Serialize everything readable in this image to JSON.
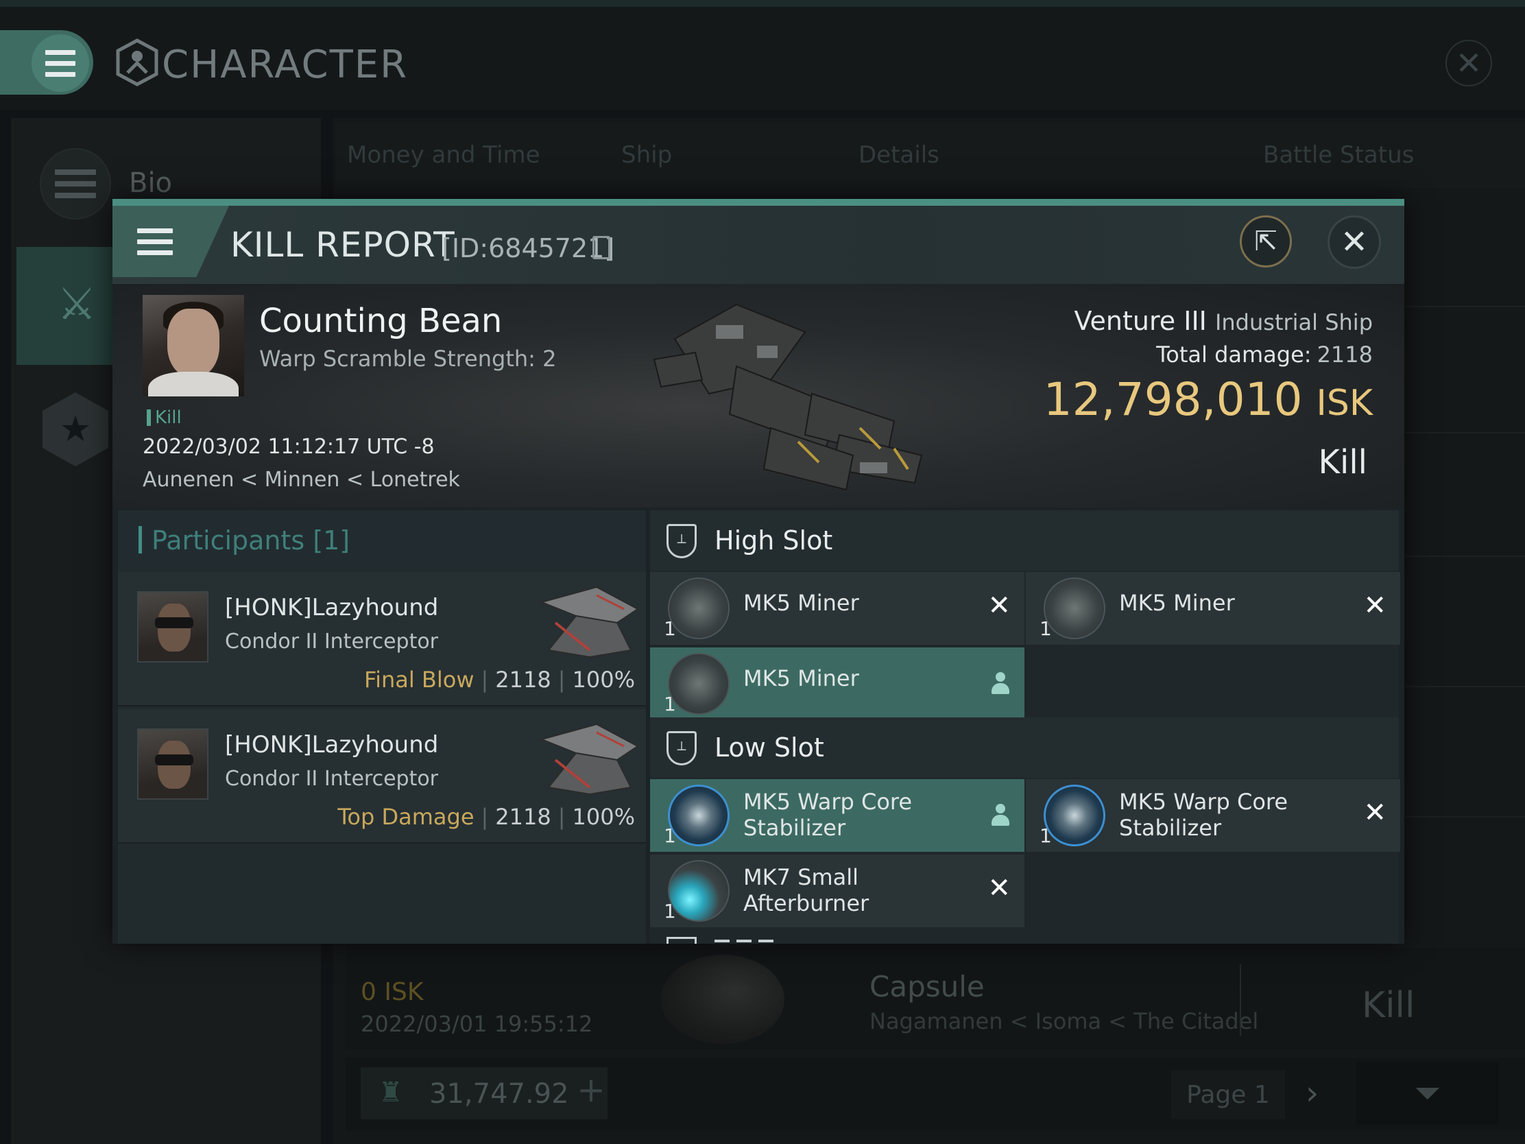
{
  "window": {
    "title": "CHARACTER"
  },
  "sidebar": {
    "items": [
      {
        "label": "Bio",
        "icon": "menu-icon"
      },
      {
        "label": "",
        "icon": "crossed-swords-icon"
      },
      {
        "label": "",
        "icon": "star-icon"
      }
    ]
  },
  "tabs": [
    "Money and Time",
    "Ship",
    "Details",
    "Battle Status"
  ],
  "background_kill": {
    "isk": "0  ISK",
    "date": "2022/03/01  19:55:12",
    "ship": "Capsule",
    "location": "Nagamanen < Isoma < The Citadel",
    "result": "Kill"
  },
  "footer": {
    "wallet_value": "31,747.92",
    "page_label": "Page 1"
  },
  "kill_report": {
    "title": "KILL REPORT",
    "id_label": "[ID:6845721]",
    "victim": {
      "name": "Counting Bean",
      "warp_scramble": "Warp Scramble Strength: 2",
      "tag": "Kill",
      "datetime": "2022/03/02 11:12:17 UTC -8",
      "location": "Aunenen < Minnen < Lonetrek"
    },
    "ship": {
      "name": "Venture III",
      "class": "Industrial Ship",
      "total_damage_label": "Total damage:",
      "total_damage": "2118",
      "isk_value": "12,798,010",
      "isk_unit": "ISK",
      "result": "Kill"
    },
    "participants_title": "Participants [1]",
    "participants": [
      {
        "name": "[HONK]Lazyhound",
        "ship": "Condor II Interceptor",
        "role": "Final Blow",
        "damage": "2118",
        "percent": "100%"
      },
      {
        "name": "[HONK]Lazyhound",
        "ship": "Condor II Interceptor",
        "role": "Top Damage",
        "damage": "2118",
        "percent": "100%"
      }
    ],
    "high_slot": {
      "label": "High Slot",
      "items": [
        {
          "name": "MK5 Miner",
          "qty": "1",
          "status": "destroyed"
        },
        {
          "name": "MK5 Miner",
          "qty": "1",
          "status": "destroyed"
        },
        {
          "name": "MK5 Miner",
          "qty": "1",
          "status": "dropped"
        }
      ]
    },
    "low_slot": {
      "label": "Low Slot",
      "items": [
        {
          "name": "MK5 Warp Core Stabilizer",
          "qty": "1",
          "status": "dropped"
        },
        {
          "name": "MK5 Warp Core Stabilizer",
          "qty": "1",
          "status": "destroyed"
        },
        {
          "name": "MK7 Small Afterburner",
          "qty": "1",
          "status": "destroyed"
        }
      ]
    }
  },
  "colors": {
    "accent": "#4b8f83",
    "isk_gold": "#e8c87e",
    "dropped_bg": "#3c6a62",
    "role_gold": "#c9a85c"
  }
}
